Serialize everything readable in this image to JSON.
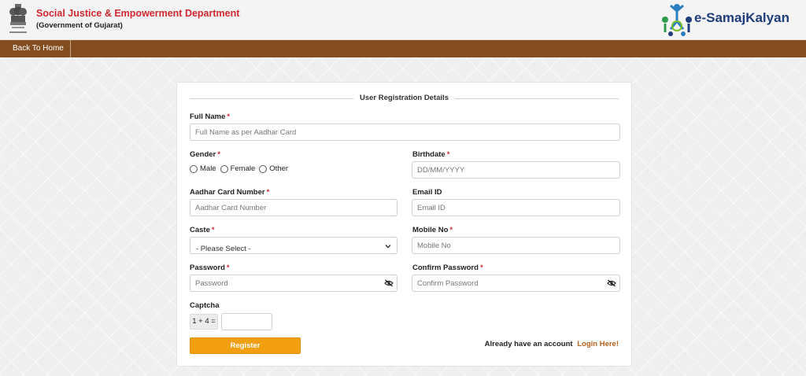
{
  "header": {
    "department": "Social Justice & Empowerment Department",
    "government": "(Government of Gujarat)",
    "logo_text": "e-SamajKalyan",
    "emblem_icon": "state-emblem-icon",
    "logo_icon": "people-group-logo-icon"
  },
  "nav": {
    "back_home": "Back To Home"
  },
  "form": {
    "title": "User Registration Details",
    "full_name": {
      "label": "Full Name",
      "required": "*",
      "placeholder": "Full Name as per Aadhar Card"
    },
    "gender": {
      "label": "Gender",
      "required": "*",
      "options": [
        "Male",
        "Female",
        "Other"
      ]
    },
    "birthdate": {
      "label": "Birthdate",
      "required": "*",
      "placeholder": "DD/MM/YYYY"
    },
    "aadhar": {
      "label": "Aadhar Card Number",
      "required": "*",
      "placeholder": "Aadhar Card Number"
    },
    "email": {
      "label": "Email ID",
      "placeholder": "Email ID"
    },
    "caste": {
      "label": "Caste",
      "required": "*",
      "selected": "- Please Select -"
    },
    "mobile": {
      "label": "Mobile No",
      "required": "*",
      "placeholder": "Mobile No"
    },
    "password": {
      "label": "Password",
      "required": "*",
      "placeholder": "Password",
      "icon": "eye-slash-icon"
    },
    "confirm_password": {
      "label": "Confirm Password",
      "required": "*",
      "placeholder": "Confirm Password",
      "icon": "eye-slash-icon"
    },
    "captcha": {
      "label": "Captcha",
      "question": "1 + 4 =",
      "value": ""
    },
    "register_label": "Register",
    "login_prompt": "Already have an account",
    "login_link": "Login Here!"
  },
  "colors": {
    "header_title": "#d0282f",
    "navbar": "#834d20",
    "register_button": "#f2a012",
    "login_link": "#b8611a",
    "logo_text": "#1f3d7a"
  }
}
